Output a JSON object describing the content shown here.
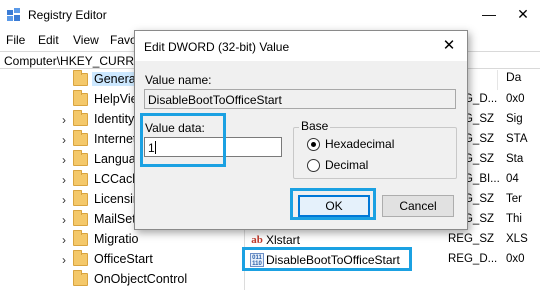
{
  "window": {
    "title": "Registry Editor",
    "minimize": "—",
    "close": "✕"
  },
  "menu": [
    "File",
    "Edit",
    "View",
    "Favo"
  ],
  "address": "Computer\\HKEY_CURRE",
  "tree": {
    "items": [
      {
        "label": "General",
        "chevron": "",
        "selected": true
      },
      {
        "label": "HelpVie",
        "chevron": ""
      },
      {
        "label": "Identity",
        "chevron": "›"
      },
      {
        "label": "Internet",
        "chevron": "›"
      },
      {
        "label": "Langua",
        "chevron": "›"
      },
      {
        "label": "LCCach",
        "chevron": "›"
      },
      {
        "label": "Licensin",
        "chevron": "›"
      },
      {
        "label": "MailSett",
        "chevron": "›"
      },
      {
        "label": "Migratio",
        "chevron": "›"
      },
      {
        "label": "OfficeStart",
        "chevron": "›"
      },
      {
        "label": "OnObjectControl",
        "chevron": ""
      }
    ]
  },
  "list": {
    "headers": {
      "name": "",
      "type": "e",
      "data": "Da"
    },
    "rows": [
      {
        "icon": "sz",
        "icon_glyph": "ab",
        "name": "",
        "type": "REG_D...",
        "data": "0x0"
      },
      {
        "icon": "sz",
        "icon_glyph": "ab",
        "name": "",
        "type": "REG_SZ",
        "data": "Sig"
      },
      {
        "icon": "sz",
        "icon_glyph": "ab",
        "name": "",
        "type": "REG_SZ",
        "data": "STA"
      },
      {
        "icon": "sz",
        "icon_glyph": "ab",
        "name": "",
        "type": "REG_SZ",
        "data": "Sta"
      },
      {
        "icon": "sz",
        "icon_glyph": "ab",
        "name": "",
        "type": "REG_BI...",
        "data": "04"
      },
      {
        "icon": "sz",
        "icon_glyph": "ab",
        "name": "",
        "type": "REG_SZ",
        "data": "Ter"
      },
      {
        "icon": "sz",
        "icon_glyph": "ab",
        "name": "",
        "type": "REG_SZ",
        "data": "Thi"
      },
      {
        "icon": "sz",
        "icon_glyph": "ab",
        "name": "Xlstart",
        "type": "REG_SZ",
        "data": "XLS"
      },
      {
        "icon": "dword",
        "icon_glyph": "011 110",
        "name": "DisableBootToOfficeStart",
        "type": "REG_D...",
        "data": "0x0"
      }
    ]
  },
  "dialog": {
    "title": "Edit DWORD (32-bit) Value",
    "close": "✕",
    "value_name_label": "Value name:",
    "value_name": "DisableBootToOfficeStart",
    "value_data_label": "Value data:",
    "value_data": "1",
    "base_label": "Base",
    "base_options": [
      {
        "label": "Hexadecimal",
        "checked": true
      },
      {
        "label": "Decimal",
        "checked": false
      }
    ],
    "ok_label": "OK",
    "cancel_label": "Cancel"
  },
  "colors": {
    "highlight": "#1ba1e2",
    "selection": "#cce8ff",
    "folder": "#f4c86a",
    "default_button_border": "#0078d7"
  }
}
